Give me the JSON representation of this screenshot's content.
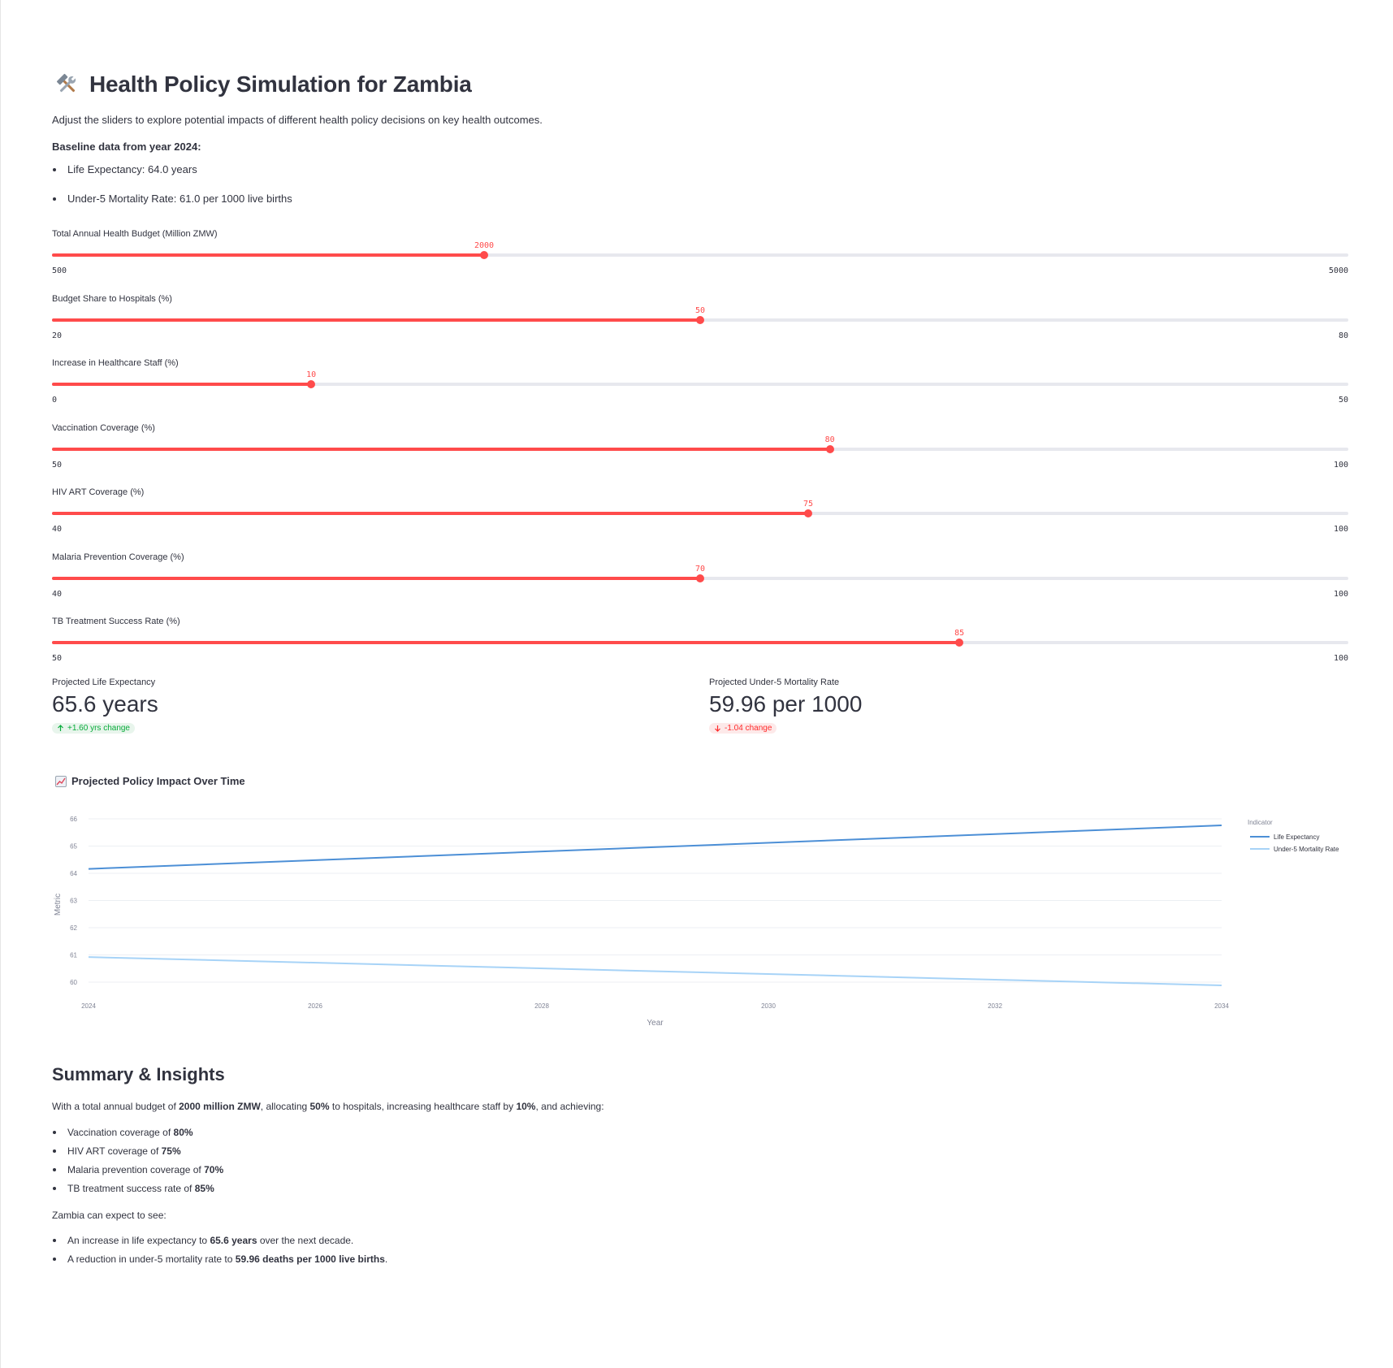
{
  "page": {
    "title": "Health Policy Simulation for Zambia",
    "title_icon": "hammer-wrench-icon",
    "intro": "Adjust the sliders to explore potential impacts of different health policy decisions on key health outcomes.",
    "baseline_heading": "Baseline data from year 2024:",
    "baseline_items": [
      "Life Expectancy: 64.0 years",
      "Under-5 Mortality Rate: 61.0 per 1000 live births"
    ]
  },
  "sliders": [
    {
      "label": "Total Annual Health Budget (Million ZMW)",
      "value": 2000,
      "min": 500,
      "max": 5000
    },
    {
      "label": "Budget Share to Hospitals (%)",
      "value": 50,
      "min": 20,
      "max": 80
    },
    {
      "label": "Increase in Healthcare Staff (%)",
      "value": 10,
      "min": 0,
      "max": 50
    },
    {
      "label": "Vaccination Coverage (%)",
      "value": 80,
      "min": 50,
      "max": 100
    },
    {
      "label": "HIV ART Coverage (%)",
      "value": 75,
      "min": 40,
      "max": 100
    },
    {
      "label": "Malaria Prevention Coverage (%)",
      "value": 70,
      "min": 40,
      "max": 100
    },
    {
      "label": "TB Treatment Success Rate (%)",
      "value": 85,
      "min": 50,
      "max": 100
    }
  ],
  "metrics": {
    "life_expectancy": {
      "label": "Projected Life Expectancy",
      "value": "65.6 years",
      "delta": "+1.60 yrs change",
      "direction": "up",
      "color": "#09ab3b"
    },
    "mortality": {
      "label": "Projected Under-5 Mortality Rate",
      "value": "59.96 per 1000",
      "delta": "-1.04 change",
      "direction": "down",
      "color": "#ff2b2b"
    }
  },
  "chart_heading": "Projected Policy Impact Over Time",
  "chart_heading_icon": "chart-increasing-icon",
  "chart_data": {
    "type": "line",
    "xlabel": "Year",
    "ylabel": "Metric",
    "x_ticks": [
      2024,
      2026,
      2028,
      2030,
      2032,
      2034
    ],
    "y_ticks": [
      60,
      61,
      62,
      63,
      64,
      65,
      66
    ],
    "xlim": [
      2024,
      2034
    ],
    "ylim": [
      59.7,
      66
    ],
    "grid": true,
    "legend_title": "Indicator",
    "legend_position": "right",
    "series": [
      {
        "name": "Life Expectancy",
        "color": "#4c8fd6",
        "x": [
          2024,
          2034
        ],
        "y": [
          64.16,
          65.76
        ]
      },
      {
        "name": "Under-5 Mortality Rate",
        "color": "#a7d3f7",
        "x": [
          2024,
          2034
        ],
        "y": [
          60.92,
          59.88
        ]
      }
    ]
  },
  "summary": {
    "title": "Summary & Insights",
    "intro_parts": [
      "With a total annual budget of ",
      "2000 million ZMW",
      ", allocating ",
      "50%",
      " to hospitals, increasing healthcare staff by ",
      "10%",
      ", and achieving:"
    ],
    "coverage_items": [
      {
        "prefix": "Vaccination coverage of ",
        "value": "80%"
      },
      {
        "prefix": "HIV ART coverage of ",
        "value": "75%"
      },
      {
        "prefix": "Malaria prevention coverage of ",
        "value": "70%"
      },
      {
        "prefix": "TB treatment success rate of ",
        "value": "85%"
      }
    ],
    "expect_heading": "Zambia can expect to see:",
    "outcomes": [
      {
        "prefix": "An increase in life expectancy to ",
        "value": "65.6 years",
        "suffix": " over the next decade."
      },
      {
        "prefix": "A reduction in under-5 mortality rate to ",
        "value": "59.96 deaths per 1000 live births",
        "suffix": "."
      }
    ]
  }
}
